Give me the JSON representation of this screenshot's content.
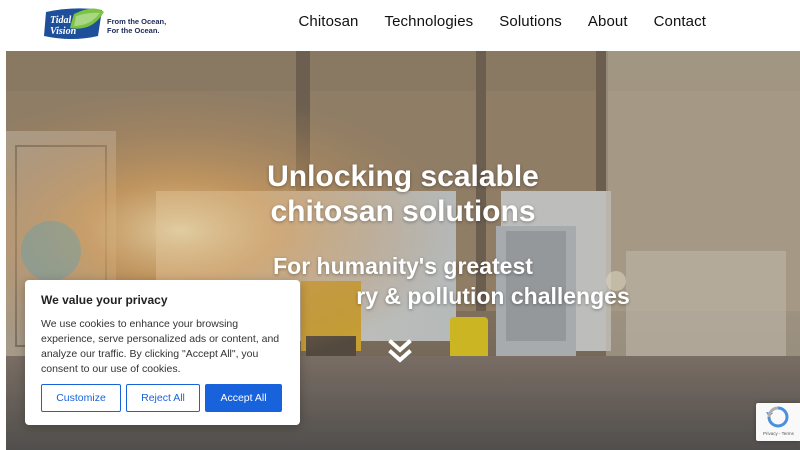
{
  "header": {
    "logo_text": "Tidal Vision",
    "logo_tagline": "From the Ocean,\nFor the Ocean.",
    "nav": [
      "Chitosan",
      "Technologies",
      "Solutions",
      "About",
      "Contact"
    ]
  },
  "hero": {
    "title_line1": "Unlocking scalable",
    "title_line2": "chitosan solutions",
    "subtitle_line1": "For humanity's greatest",
    "subtitle_line2": "ry & pollution challenges",
    "scroll_icon": "double-chevron-down-icon"
  },
  "cookie": {
    "title": "We value your privacy",
    "body": "We use cookies to enhance your browsing experience, serve personalized ads or content, and analyze our traffic. By clicking \"Accept All\", you consent to our use of cookies.",
    "customize_label": "Customize",
    "reject_label": "Reject All",
    "accept_label": "Accept All"
  },
  "recaptcha": {
    "label": "Privacy - Terms"
  },
  "colors": {
    "accent": "#1863dc",
    "brand_blue": "#1d4f9a",
    "brand_green": "#7cc243"
  }
}
